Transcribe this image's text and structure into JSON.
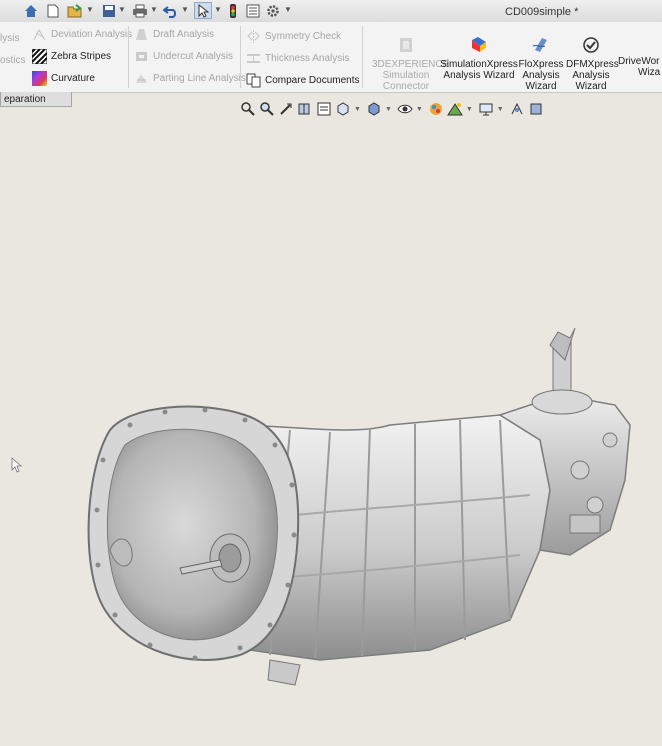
{
  "window": {
    "document_title": "CD009simple *"
  },
  "quick_access": {
    "icons": [
      "home-icon",
      "new-document-icon",
      "open-icon",
      "save-icon",
      "print-icon",
      "undo-icon",
      "select-icon",
      "rebuild-icon",
      "file-properties-icon",
      "options-icon"
    ]
  },
  "ribbon": {
    "left_cut_labels": [
      "lysis",
      "ostics"
    ],
    "col1": {
      "deviation": "Deviation Analysis",
      "zebra": "Zebra Stripes",
      "curvature": "Curvature"
    },
    "col2": {
      "draft": "Draft Analysis",
      "undercut": "Undercut Analysis",
      "parting": "Parting Line Analysis"
    },
    "col3": {
      "symmetry": "Symmetry Check",
      "thickness": "Thickness Analysis",
      "compare": "Compare Documents"
    },
    "big_tools": {
      "experience": [
        "3DEXPERIENCE",
        "Simulation",
        "Connector"
      ],
      "simxpress": [
        "SimulationXpress",
        "Analysis Wizard"
      ],
      "floxpress": [
        "FloXpress",
        "Analysis",
        "Wizard"
      ],
      "dfmxpress": [
        "DFMXpress",
        "Analysis",
        "Wizard"
      ],
      "driveworks": [
        "DriveWor",
        "Wiza"
      ]
    }
  },
  "tabs": {
    "separation": "eparation"
  },
  "heads_up": {
    "icons": [
      "zoom-to-fit-icon",
      "zoom-to-area-icon",
      "previous-view-icon",
      "section-view-icon",
      "dynamic-annotation-icon",
      "view-orientation-icon",
      "display-style-icon",
      "hide-show-icon",
      "edit-appearance-icon",
      "apply-scene-icon",
      "view-settings-icon",
      "display-pane-icon",
      "realview-icon"
    ]
  },
  "viewport": {
    "model": "transmission-scan-mesh"
  }
}
